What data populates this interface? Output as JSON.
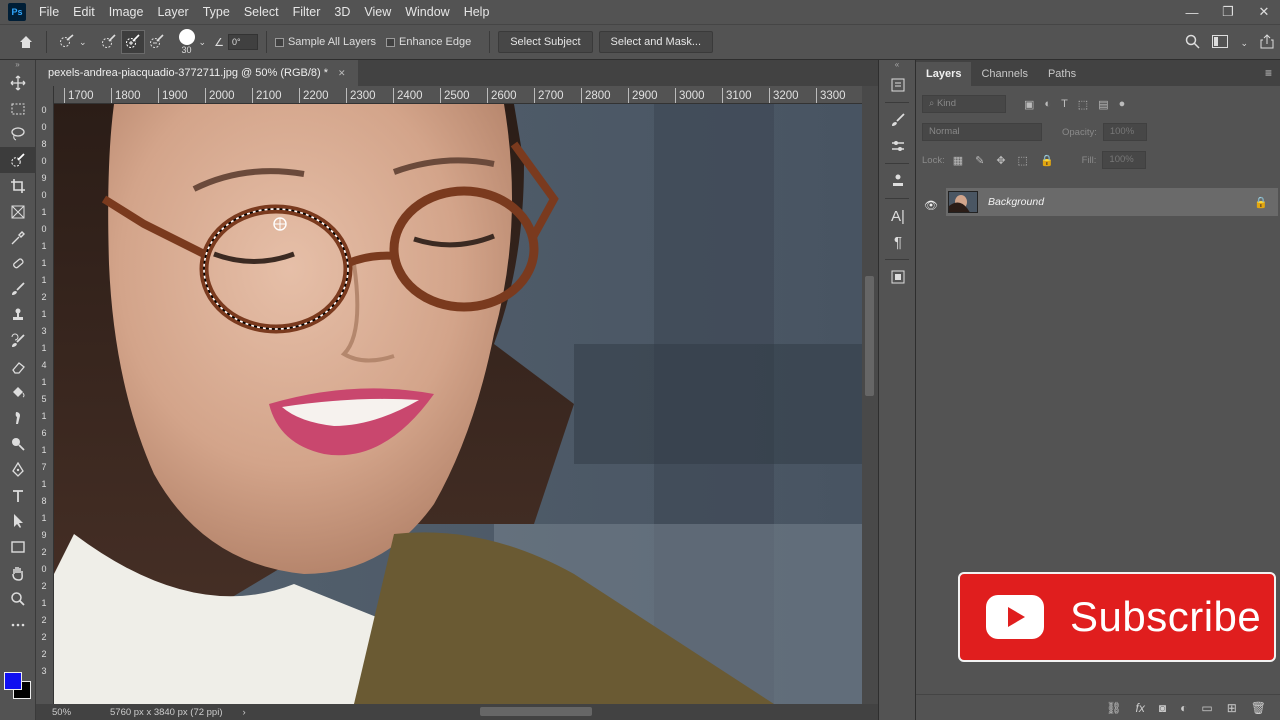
{
  "app": {
    "logo_text": "Ps"
  },
  "menu": [
    "File",
    "Edit",
    "Image",
    "Layer",
    "Type",
    "Select",
    "Filter",
    "3D",
    "View",
    "Window",
    "Help"
  ],
  "window_controls": {
    "minimize": "—",
    "restore": "❐",
    "close": "✕"
  },
  "options_bar": {
    "brush_size": "30",
    "angle": "0°",
    "sample_all_layers": "Sample All Layers",
    "enhance_edge": "Enhance Edge",
    "select_subject": "Select Subject",
    "select_and_mask": "Select and Mask..."
  },
  "document": {
    "tab_title": "pexels-andrea-piacquadio-3772711.jpg @ 50% (RGB/8) *",
    "close_glyph": "✕"
  },
  "ruler_top": [
    "1700",
    "1800",
    "1900",
    "2000",
    "2100",
    "2200",
    "2300",
    "2400",
    "2500",
    "2600",
    "2700",
    "2800",
    "2900",
    "3000",
    "3100",
    "3200",
    "3300"
  ],
  "ruler_left": [
    "0",
    "0",
    "8",
    "0",
    "9",
    "0",
    "1",
    "0",
    "1",
    "1",
    "1",
    "2",
    "1",
    "3",
    "1",
    "4",
    "1",
    "5",
    "1",
    "6",
    "1",
    "7",
    "1",
    "8",
    "1",
    "9",
    "2",
    "0",
    "2",
    "1",
    "2",
    "2",
    "2",
    "3"
  ],
  "status": {
    "zoom": "50%",
    "doc_info": "5760 px x 3840 px (72 ppi)",
    "arrow": "›"
  },
  "layers_panel": {
    "tabs": [
      "Layers",
      "Channels",
      "Paths"
    ],
    "kind_placeholder": "Kind",
    "blend_mode": "Normal",
    "opacity_label": "Opacity:",
    "opacity_value": "100%",
    "lock_label": "Lock:",
    "fill_label": "Fill:",
    "fill_value": "100%",
    "layers": [
      {
        "name": "Background",
        "visible": true,
        "locked": true
      }
    ]
  },
  "overlay": {
    "subscribe_text": "Subscribe"
  },
  "colors": {
    "foreground": "#1010f0",
    "background": "#000000",
    "subscribe_red": "#e01e1e"
  }
}
